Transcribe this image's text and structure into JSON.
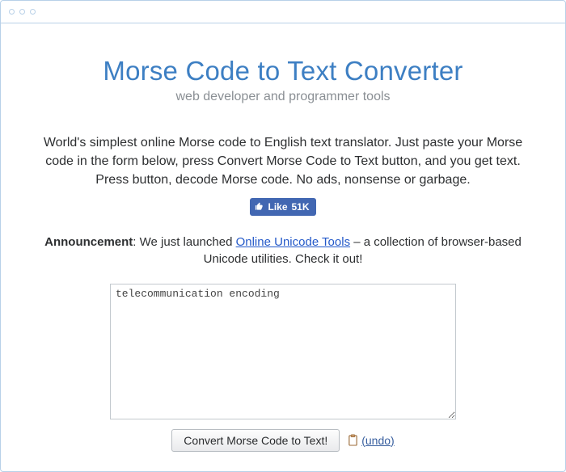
{
  "header": {
    "title": "Morse Code to Text Converter",
    "subtitle": "web developer and programmer tools"
  },
  "intro": "World's simplest online Morse code to English text translator. Just paste your Morse code in the form below, press Convert Morse Code to Text button, and you get text. Press button, decode Morse code. No ads, nonsense or garbage.",
  "fb": {
    "label": "Like",
    "count": "51K"
  },
  "announcement": {
    "label": "Announcement",
    "before": ": We just launched ",
    "link_text": "Online Unicode Tools",
    "after": " – a collection of browser-based Unicode utilities. Check it out!"
  },
  "input": {
    "value": "telecommunication encoding"
  },
  "controls": {
    "convert_label": "Convert Morse Code to Text!",
    "undo_label": "(undo)"
  }
}
